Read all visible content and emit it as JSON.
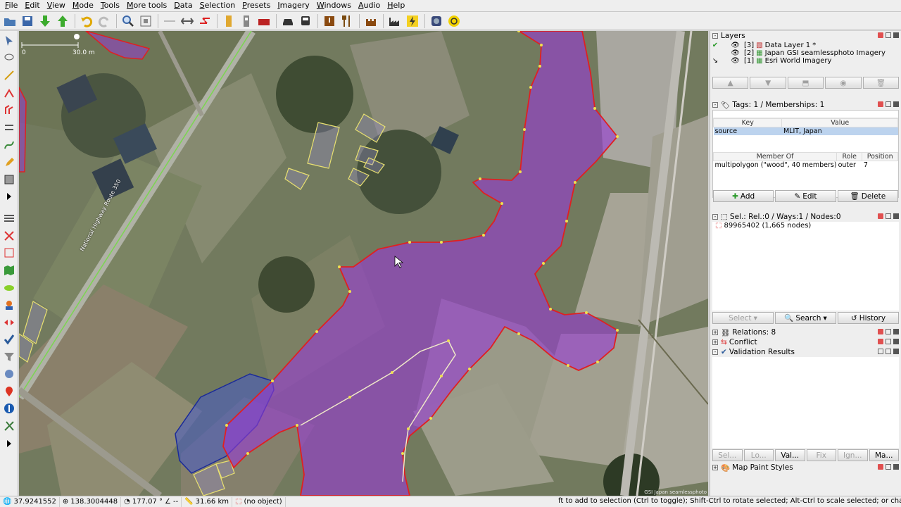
{
  "menubar": [
    "File",
    "Edit",
    "View",
    "Mode",
    "Tools",
    "More tools",
    "Data",
    "Selection",
    "Presets",
    "Imagery",
    "Windows",
    "Audio",
    "Help"
  ],
  "map": {
    "scale_start": "0",
    "scale_end": "30.0 m",
    "road_label": "National Highway Route 350",
    "attribution": "GSI Japan seamlessphoto"
  },
  "layers": {
    "title": "Layers",
    "items": [
      {
        "index": "[3]",
        "name": "Data Layer 1 *"
      },
      {
        "index": "[2]",
        "name": "Japan GSI seamlessphoto Imagery"
      },
      {
        "index": "[1]",
        "name": "Esri World Imagery"
      }
    ]
  },
  "tags": {
    "title": "Tags: 1 / Memberships: 1",
    "key_header": "Key",
    "value_header": "Value",
    "rows": [
      {
        "key": "source",
        "value": "MLIT, Japan"
      }
    ],
    "member_header": "Member Of",
    "role_header": "Role",
    "position_header": "Position",
    "memberships": [
      {
        "member": "multipolygon (\"wood\", 40 members)",
        "role": "outer",
        "position": "7"
      }
    ],
    "add": "Add",
    "edit": "Edit",
    "delete": "Delete"
  },
  "selection": {
    "title": "Sel.: Rel.:0 / Ways:1 / Nodes:0",
    "items": [
      "89965402 (1,665 nodes)"
    ],
    "select": "Select",
    "search": "Search",
    "history": "History"
  },
  "panels": {
    "relations": "Relations: 8",
    "conflict": "Conflict",
    "validation": "Validation Results",
    "map_paint": "Map Paint Styles"
  },
  "bottom_tabs": [
    "Sel...",
    "Lo...",
    "Val...",
    "Fix",
    "Ign...",
    "Ma..."
  ],
  "status": {
    "lat": "37.9241552",
    "lon": "138.3004448",
    "heading": "177.07 °",
    "angle": "--",
    "distance": "31.66 km",
    "object": "(no object)",
    "help": "ft to add to selection (Ctrl to toggle); Shift-Ctrl to rotate selected; Alt-Ctrl to scale selected; or change selection"
  }
}
